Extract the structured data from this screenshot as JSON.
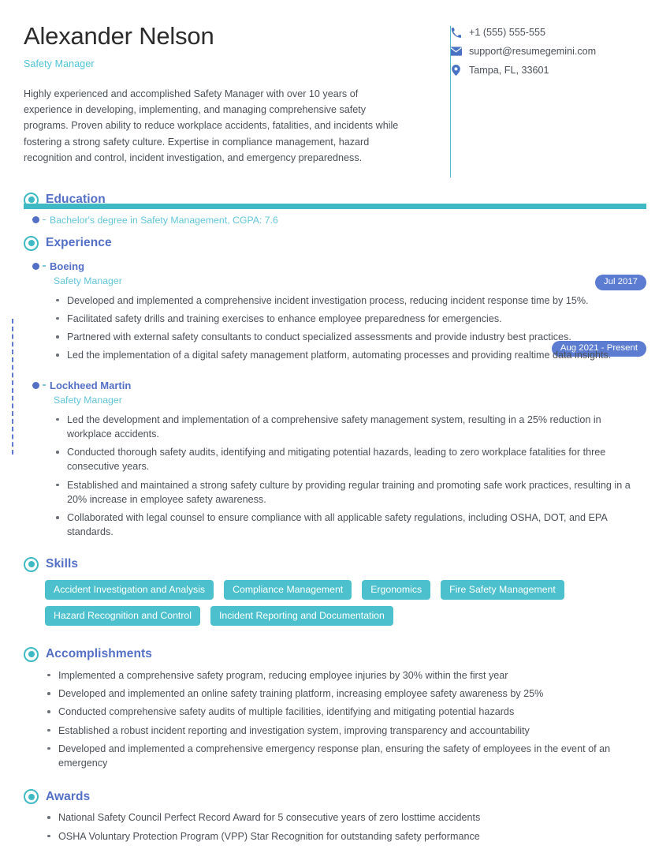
{
  "profile": {
    "name": "Alexander Nelson",
    "job_title": "Safety Manager",
    "summary": "Highly experienced and accomplished Safety Manager with over 10 years of experience in developing, implementing, and managing comprehensive safety programs. Proven ability to reduce workplace accidents, fatalities, and incidents while fostering a strong safety culture. Expertise in compliance management, hazard recognition and control, incident investigation, and emergency preparedness."
  },
  "contact": {
    "phone": "+1 (555) 555-555",
    "email": "support@resumegemini.com",
    "location": "Tampa, FL, 33601",
    "phone_icon": "phone-icon",
    "email_icon": "envelope-icon",
    "location_icon": "map-pin-icon"
  },
  "sections": {
    "education": {
      "title": "Education",
      "entry": "Bachelor's degree in Safety Management, CGPA: 7.6",
      "date_badge": "Jul 2017"
    },
    "experience": {
      "title": "Experience",
      "entries": [
        {
          "company": "Boeing",
          "role": "Safety Manager",
          "date_badge": "Aug 2021 - Present",
          "points": [
            "Developed and implemented a comprehensive incident investigation process, reducing incident response time by 15%.",
            "Facilitated safety drills and training exercises to enhance employee preparedness for emergencies.",
            "Partnered with external safety consultants to conduct specialized assessments and provide industry best practices.",
            "Led the implementation of a digital safety management platform, automating processes and providing realtime data insights."
          ]
        },
        {
          "company": "Lockheed Martin",
          "role": "Safety Manager",
          "date_badge": "",
          "points": [
            "Led the development and implementation of a comprehensive safety management system, resulting in a 25% reduction in workplace accidents.",
            "Conducted thorough safety audits, identifying and mitigating potential hazards, leading to zero workplace fatalities for three consecutive years.",
            "Established and maintained a strong safety culture by providing regular training and promoting safe work practices, resulting in a 20% increase in employee safety awareness.",
            "Collaborated with legal counsel to ensure compliance with all applicable safety regulations, including OSHA, DOT, and EPA standards."
          ]
        }
      ]
    },
    "skills": {
      "title": "Skills",
      "items": [
        "Accident Investigation and Analysis",
        "Compliance Management",
        "Ergonomics",
        "Fire Safety Management",
        "Hazard Recognition and Control",
        "Incident Reporting and Documentation"
      ]
    },
    "accomplishments": {
      "title": "Accomplishments",
      "items": [
        "Implemented a comprehensive safety program, reducing employee injuries by 30% within the first year",
        "Developed and implemented an online safety training platform, increasing employee safety awareness by 25%",
        "Conducted comprehensive safety audits of multiple facilities, identifying and mitigating potential hazards",
        "Established a robust incident reporting and investigation system, improving transparency and accountability",
        "Developed and implemented a comprehensive emergency response plan, ensuring the safety of employees in the event of an emergency"
      ]
    },
    "awards": {
      "title": "Awards",
      "items": [
        "National Safety Council Perfect Record Award for 5 consecutive years of zero losttime accidents",
        "OSHA Voluntary Protection Program (VPP) Star Recognition for outstanding safety performance"
      ]
    }
  },
  "colors": {
    "teal": "#3fbac4",
    "blue": "#5470c6",
    "cyan_text": "#63c5d8",
    "body_text": "#4b5057",
    "badge_blue": "#5b7cd1",
    "chip_teal": "#4cc0cc"
  }
}
